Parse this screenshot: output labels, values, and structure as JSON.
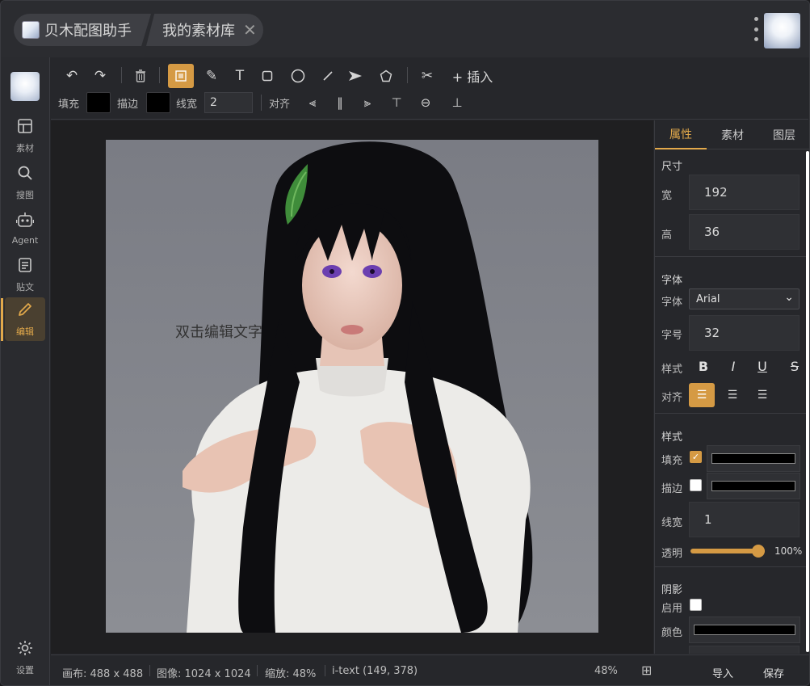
{
  "titlebar": {
    "app_tab": "贝木配图助手",
    "library_tab": "我的素材库",
    "close_glyph": "✕"
  },
  "sidebar": {
    "items": [
      {
        "label": "素材",
        "icon": "table-icon"
      },
      {
        "label": "搜图",
        "icon": "search-icon"
      },
      {
        "label": "Agent",
        "icon": "robot-icon"
      },
      {
        "label": "贴文",
        "icon": "document-icon"
      },
      {
        "label": "编辑",
        "icon": "pencil-icon",
        "active": true
      }
    ],
    "settings_label": "设置"
  },
  "toolbar": {
    "insert_label": "+ 插入",
    "fill_label": "填充",
    "stroke_label": "描边",
    "linewidth_label": "线宽",
    "linewidth_value": "2",
    "align_label": "对齐"
  },
  "canvas": {
    "text_object": "双击编辑文字"
  },
  "panel": {
    "tabs": [
      "属性",
      "素材",
      "图层"
    ],
    "size_section": "尺寸",
    "width_label": "宽",
    "width_value": "192",
    "height_label": "高",
    "height_value": "36",
    "font_section": "字体",
    "font_label": "字体",
    "font_value": "Arial",
    "size_label": "字号",
    "size_value": "32",
    "style_label": "样式",
    "align_label": "对齐",
    "style_section": "样式",
    "fill_label": "填充",
    "stroke_label": "描边",
    "linewidth_label": "线宽",
    "linewidth_value": "1",
    "opacity_label": "透明",
    "opacity_value": "100%",
    "opacity_level": 1.0,
    "shadow_section": "阴影",
    "shadow_enable_label": "启用",
    "shadow_color_label": "颜色"
  },
  "status": {
    "canvas_size": "画布: 488 x 488",
    "image_size": "图像: 1024 x 1024",
    "zoom": "缩放: 48%",
    "selection": "i-text (149, 378)",
    "zoom_pct": "48%",
    "import_label": "导入",
    "save_label": "保存"
  },
  "colors": {
    "accent": "#d59a44",
    "background": "#26272b"
  }
}
